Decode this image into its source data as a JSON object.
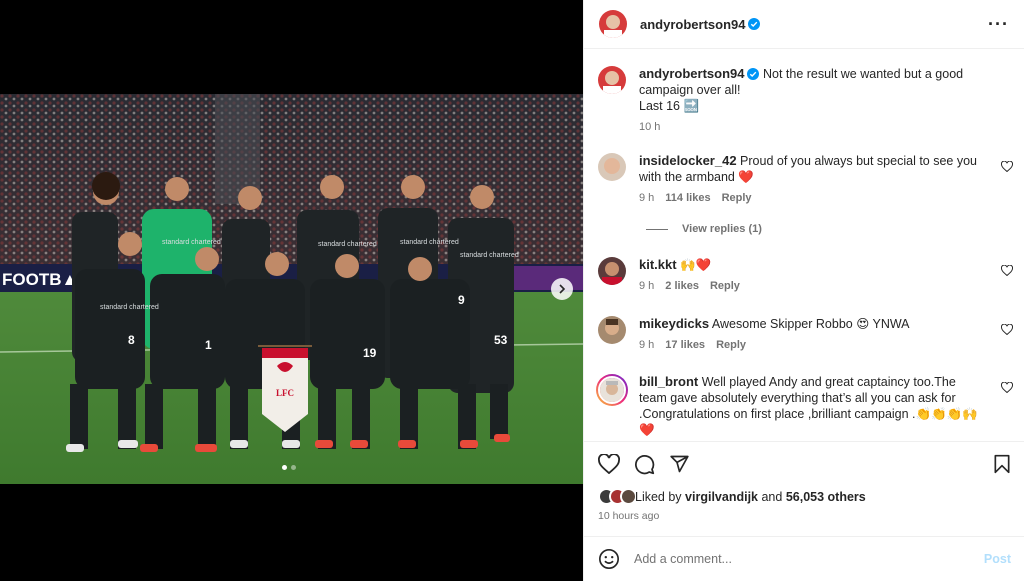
{
  "post": {
    "username": "andyrobertson94",
    "caption": "Not the result we wanted but a good campaign over all!",
    "caption_line2": "Last 16",
    "caption_emoji": "🔜",
    "caption_time": "10 h"
  },
  "comments": [
    {
      "username": "insidelocker_42",
      "text": "Proud of you always but special to see you with the armband ❤️",
      "time": "9 h",
      "likes": "114 likes",
      "reply": "Reply"
    },
    {
      "username": "kit.kkt",
      "text": "🙌❤️",
      "time": "9 h",
      "likes": "2 likes",
      "reply": "Reply"
    },
    {
      "username": "mikeydicks",
      "text": "Awesome Skipper Robbo 😍 YNWA",
      "time": "9 h",
      "likes": "17 likes",
      "reply": "Reply"
    },
    {
      "username": "bill_bront",
      "text": "Well played Andy and great captaincy too.The team gave absolutely everything that’s all you can ask for .Congratulations on first place ,brilliant campaign .👏👏👏🙌❤️"
    }
  ],
  "view_replies": "View replies (1)",
  "likes": {
    "prefix": "Liked by",
    "user": "virgilvandijk",
    "and": "and",
    "count": "56,053 others"
  },
  "timestamp": "10 hours ago",
  "add_comment": {
    "placeholder": "Add a comment...",
    "post_label": "Post"
  },
  "media": {
    "ad_board_text": "FOOTB▲L",
    "pennant_text": "LFC",
    "sponsor": "standard chartered",
    "numbers": [
      "8",
      "19",
      "53",
      "1",
      "9"
    ]
  },
  "colors": {
    "verified": "#0095f6",
    "accent_link": "#b2dffc",
    "kit": "#1f2426",
    "keeper": "#1eb36b"
  }
}
